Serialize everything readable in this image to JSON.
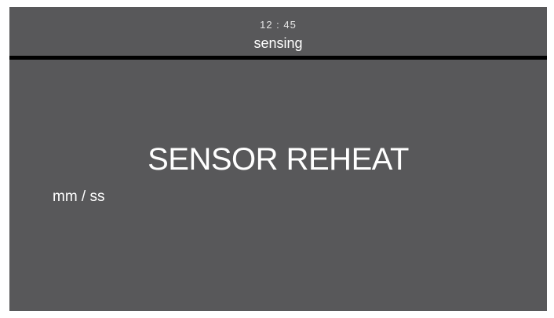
{
  "status_bar": {
    "clock": "12 : 45",
    "mode": "sensing"
  },
  "main": {
    "message": "SENSOR REHEAT",
    "timer_unit": "mm / ss"
  },
  "colors": {
    "screen_background": "#58585a",
    "divider": "#000000",
    "text": "#ffffff"
  }
}
